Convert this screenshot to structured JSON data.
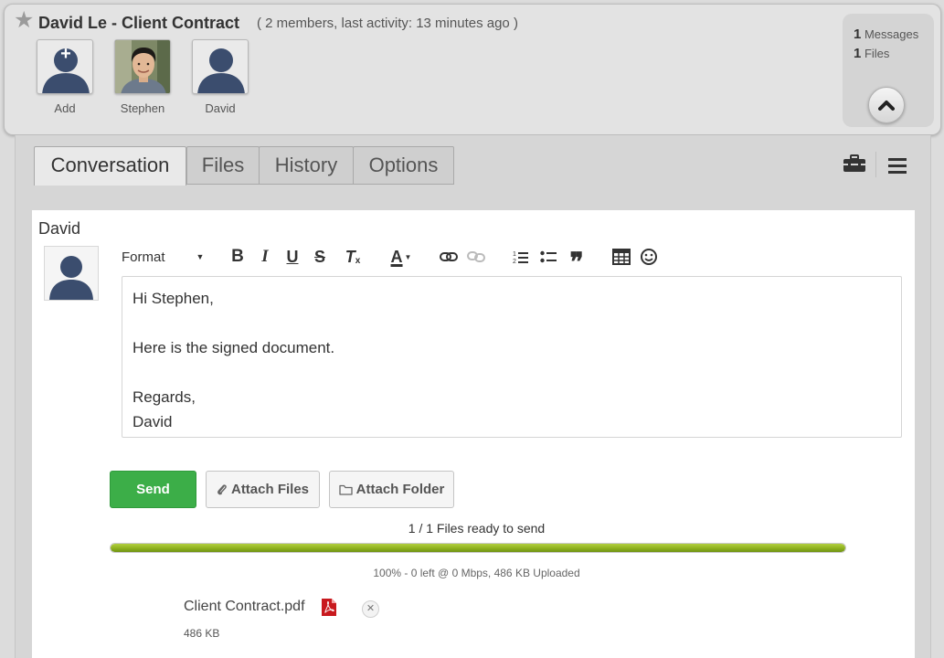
{
  "conversation": {
    "title": "David Le - Client Contract",
    "subtitle": "( 2 members, last activity: 13 minutes ago )",
    "members": [
      {
        "label": "Add",
        "icon": "add-member-icon"
      },
      {
        "label": "Stephen",
        "icon": "stephen-photo"
      },
      {
        "label": "David",
        "icon": "default-avatar-icon"
      }
    ],
    "stats": {
      "messages_count": "1",
      "messages_label": "Messages",
      "files_count": "1",
      "files_label": "Files"
    }
  },
  "tabs": [
    "Conversation",
    "Files",
    "History",
    "Options"
  ],
  "active_tab": "Conversation",
  "compose": {
    "author": "David",
    "toolbar": {
      "format_label": "Format",
      "buttons": [
        "bold",
        "italic",
        "underline",
        "strikethrough",
        "clear-format",
        "text-color",
        "link",
        "unlink",
        "numbered-list",
        "bulleted-list",
        "blockquote",
        "table",
        "emoji"
      ]
    },
    "body_lines": [
      "Hi Stephen,",
      "",
      "Here is the signed document.",
      "",
      "Regards,",
      "David"
    ],
    "send_label": "Send",
    "attach_files_label": "Attach Files",
    "attach_folder_label": "Attach Folder"
  },
  "upload": {
    "ready_text": "1 / 1 Files ready to send",
    "progress_percent": 100,
    "info_text": "100% - 0 left @ 0 Mbps, 486 KB Uploaded",
    "file": {
      "name": "Client Contract.pdf",
      "size": "486 KB",
      "icon": "pdf-file-icon"
    }
  },
  "colors": {
    "send": "#3cae48",
    "progress": "#8bae1d",
    "pdf": "#c8191e",
    "avatar": "#3b4d6e"
  }
}
